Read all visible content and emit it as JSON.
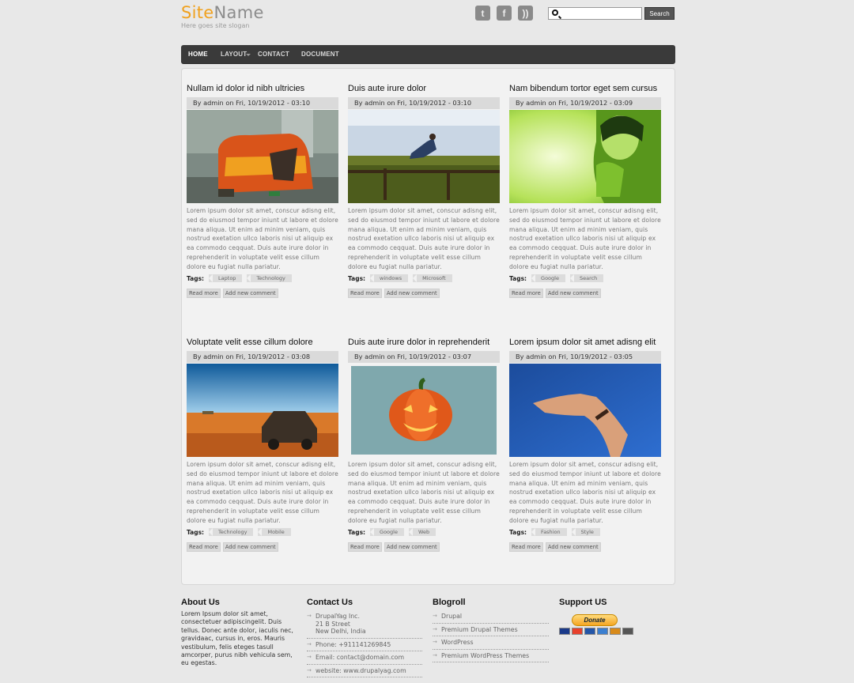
{
  "header": {
    "logo_a": "Site",
    "logo_b": "Name",
    "slogan": "Here goes site slogan",
    "search_placeholder": "",
    "search_button": "Search",
    "social": {
      "twitter": "t",
      "facebook": "f",
      "rss": "))"
    }
  },
  "nav": {
    "items": [
      "HOME",
      "LAYOUT",
      "CONTACT",
      "DOCUMENT"
    ]
  },
  "posts": [
    {
      "title": "Nullam id dolor id nibh ultricies",
      "meta": "By admin on Fri, 10/19/2012 - 03:10",
      "tags": [
        "Laptop",
        "Technology"
      ]
    },
    {
      "title": "Duis aute irure dolor",
      "meta": "By admin on Fri, 10/19/2012 - 03:10",
      "tags": [
        "windows",
        "Microsoft"
      ]
    },
    {
      "title": "Nam bibendum tortor eget sem cursus",
      "meta": "By admin on Fri, 10/19/2012 - 03:09",
      "tags": [
        "Google",
        "Search"
      ]
    },
    {
      "title": "Voluptate velit esse cillum dolore",
      "meta": "By admin on Fri, 10/19/2012 - 03:08",
      "tags": [
        "Technology",
        "Mobile"
      ]
    },
    {
      "title": "Duis aute irure dolor in reprehenderit",
      "meta": "By admin on Fri, 10/19/2012 - 03:07",
      "tags": [
        "Google",
        "Web"
      ]
    },
    {
      "title": "Lorem ipsum dolor sit amet adisng elit",
      "meta": "By admin on Fri, 10/19/2012 - 03:05",
      "tags": [
        "Fashion",
        "Style"
      ]
    }
  ],
  "post_body": "Lorem ipsum dolor sit amet, conscur adisng elit, sed do eiusmod tempor iniunt ut labore et dolore mana aliqua. Ut enim ad minim veniam, quis nostrud exetation ullco laboris nisi ut aliquip ex ea commodo ceqquat. Duis aute irure dolor in reprehenderit in voluptate velit esse cillum dolore eu fugiat nulla pariatur.",
  "labels": {
    "tags": "Tags:",
    "read_more": "Read more",
    "add_comment": "Add new comment"
  },
  "footer": {
    "about": {
      "title": "About Us",
      "text": "Lorem Ipsum dolor sit amet, consectetuer adipiscingelit. Duis tellus. Donec ante dolor, iaculis nec, gravidaac, cursus in, eros. Mauris vestibulum, felis eteges tasull amcorper, purus nibh vehicula sem, eu egestas."
    },
    "contact": {
      "title": "Contact Us",
      "address": [
        "DrupalYag Inc.",
        "21 B Street",
        "New Delhi, India"
      ],
      "phone": "Phone: +911141269845",
      "email": "Email: contact@domain.com",
      "website": "website: www.drupalyag.com"
    },
    "blogroll": {
      "title": "Blogroll",
      "items": [
        "Drupal",
        "Premium Drupal Themes",
        "WordPress",
        "Premium WordPress Themes"
      ]
    },
    "support": {
      "title": "Support US",
      "donate": "Donate"
    }
  }
}
